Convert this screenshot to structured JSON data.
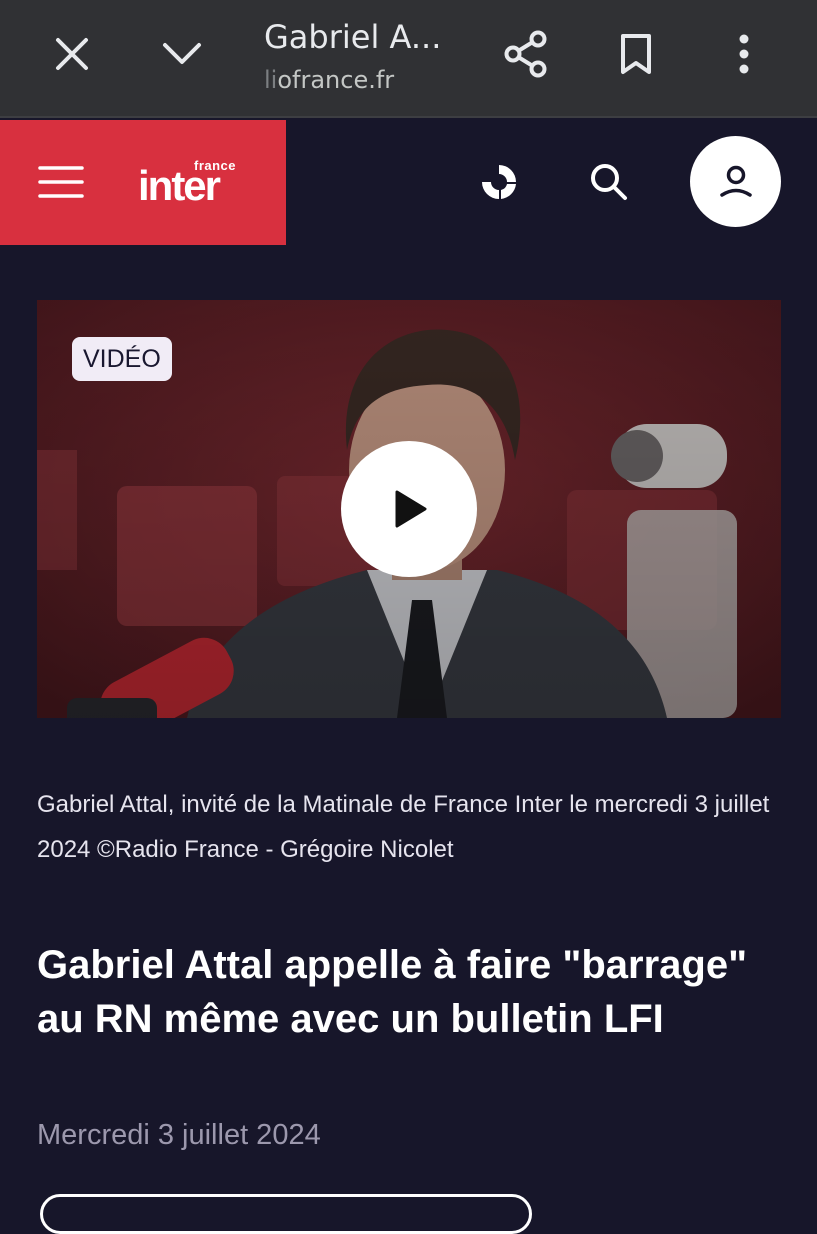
{
  "browser": {
    "title": "Gabriel A...",
    "url_faded": "li",
    "url": "ofrance.fr",
    "icons": [
      "close-icon",
      "chevron-down-icon",
      "share-icon",
      "bookmark-icon",
      "more-vert-icon"
    ]
  },
  "header": {
    "logo_small": "france",
    "logo_big": "inter",
    "brand_color": "#d8303f",
    "icons": [
      "menu-icon",
      "radio-live-icon",
      "search-icon",
      "account-icon"
    ]
  },
  "video": {
    "badge": "VIDÉO",
    "play_icon": "play-icon"
  },
  "article": {
    "caption": "Gabriel Attal, invité de la Matinale de France Inter le mercredi 3 juillet 2024 ©Radio France - Grégoire Nicolet",
    "headline": "Gabriel Attal appelle à faire \"barrage\" au RN même avec un bulletin LFI",
    "date": "Mercredi 3 juillet 2024"
  },
  "colors": {
    "background": "#17162a",
    "toolbar": "#303134",
    "date_text": "#9c98ad"
  }
}
